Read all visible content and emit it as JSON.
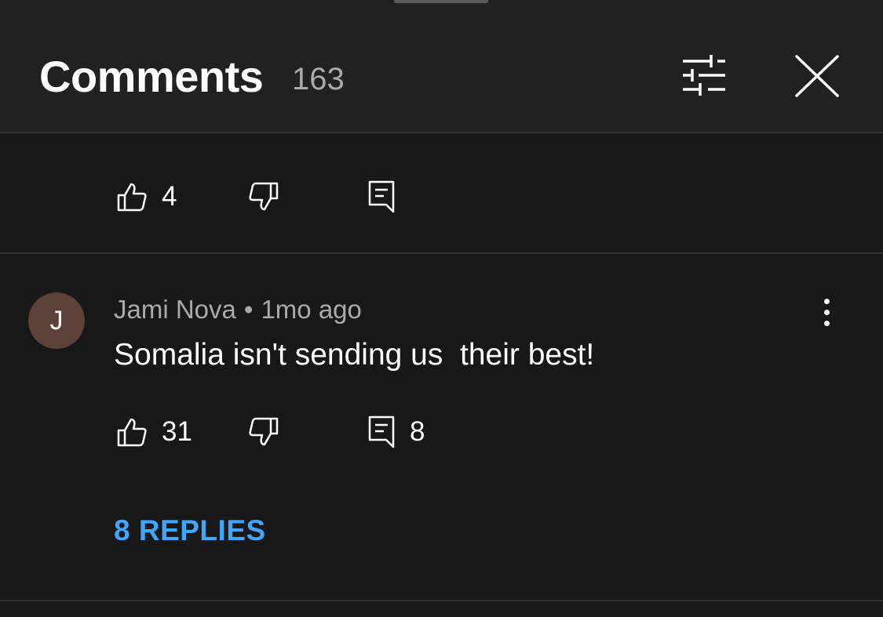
{
  "header": {
    "title": "Comments",
    "count": "163"
  },
  "previous_comment": {
    "likes": "4"
  },
  "comment": {
    "avatar_initial": "J",
    "author": "Jami Nova",
    "separator": "•",
    "time": "1mo ago",
    "text": "Somalia isn't sending us  their best!",
    "likes": "31",
    "reply_count": "8",
    "replies_label": "8 REPLIES"
  },
  "icons": {
    "filter": "sliders-icon",
    "close": "close-icon",
    "like": "thumbs-up-icon",
    "dislike": "thumbs-down-icon",
    "reply": "comment-icon",
    "more": "more-vertical-icon"
  },
  "colors": {
    "background": "#181818",
    "header_background": "#212121",
    "link": "#3ea6ff",
    "avatar": "#5d4037",
    "muted_text": "#aaaaaa"
  }
}
